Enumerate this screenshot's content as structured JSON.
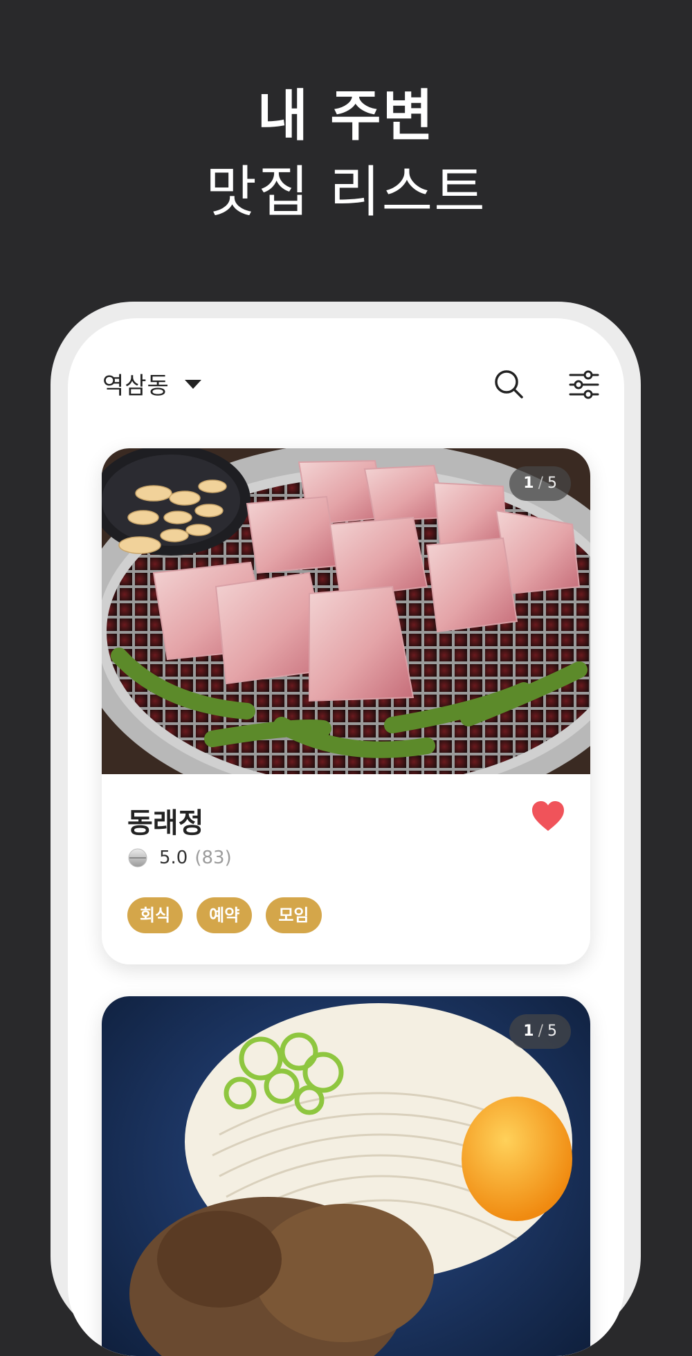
{
  "hero": {
    "title": "내 주변",
    "subtitle": "맛집 리스트"
  },
  "header": {
    "location": "역삼동"
  },
  "icons": {
    "location_dropdown": "caret-down-icon",
    "search": "search-icon",
    "filter": "filter-sliders-icon",
    "favorite": "heart-icon",
    "rating": "rating-ball-icon"
  },
  "restaurants": [
    {
      "name": "동래정",
      "photo": {
        "current": "1",
        "total": "5",
        "separator": "/"
      },
      "rating": "5.0",
      "review_count": "(83)",
      "favorited": true,
      "tags": [
        "회식",
        "예약",
        "모임"
      ]
    },
    {
      "photo": {
        "current": "1",
        "total": "5",
        "separator": "/"
      }
    }
  ],
  "colors": {
    "background": "#29292b",
    "tag": "#d4a64a",
    "heart": "#f0535a"
  }
}
